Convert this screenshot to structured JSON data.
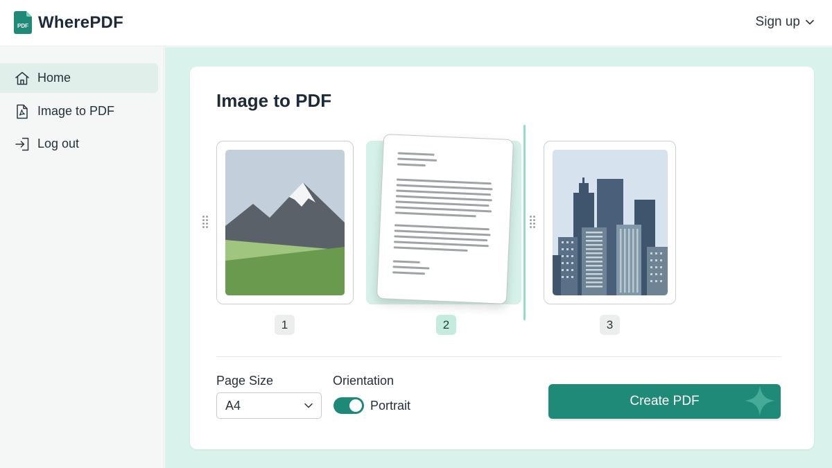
{
  "app": {
    "name": "WherePDF",
    "logo_badge": "PDF",
    "brand_color": "#1f8a78"
  },
  "header": {
    "signup_label": "Sign up",
    "signup_icon": "chevron-down-icon"
  },
  "sidebar": {
    "items": [
      {
        "label": "Home",
        "icon": "home-icon",
        "active": true
      },
      {
        "label": "Image to PDF",
        "icon": "pdf-file-icon",
        "active": false
      },
      {
        "label": "Log out",
        "icon": "logout-icon",
        "active": false
      }
    ]
  },
  "main": {
    "title": "Image to PDF",
    "pages": [
      {
        "number": "1",
        "content": "landscape-image",
        "selected": false
      },
      {
        "number": "2",
        "content": "text-document",
        "selected": true
      },
      {
        "number": "3",
        "content": "city-image",
        "selected": false
      }
    ],
    "page_size": {
      "label": "Page Size",
      "value": "A4"
    },
    "orientation": {
      "label": "Orientation",
      "value": "Portrait",
      "enabled": true
    },
    "create_button": "Create PDF"
  }
}
